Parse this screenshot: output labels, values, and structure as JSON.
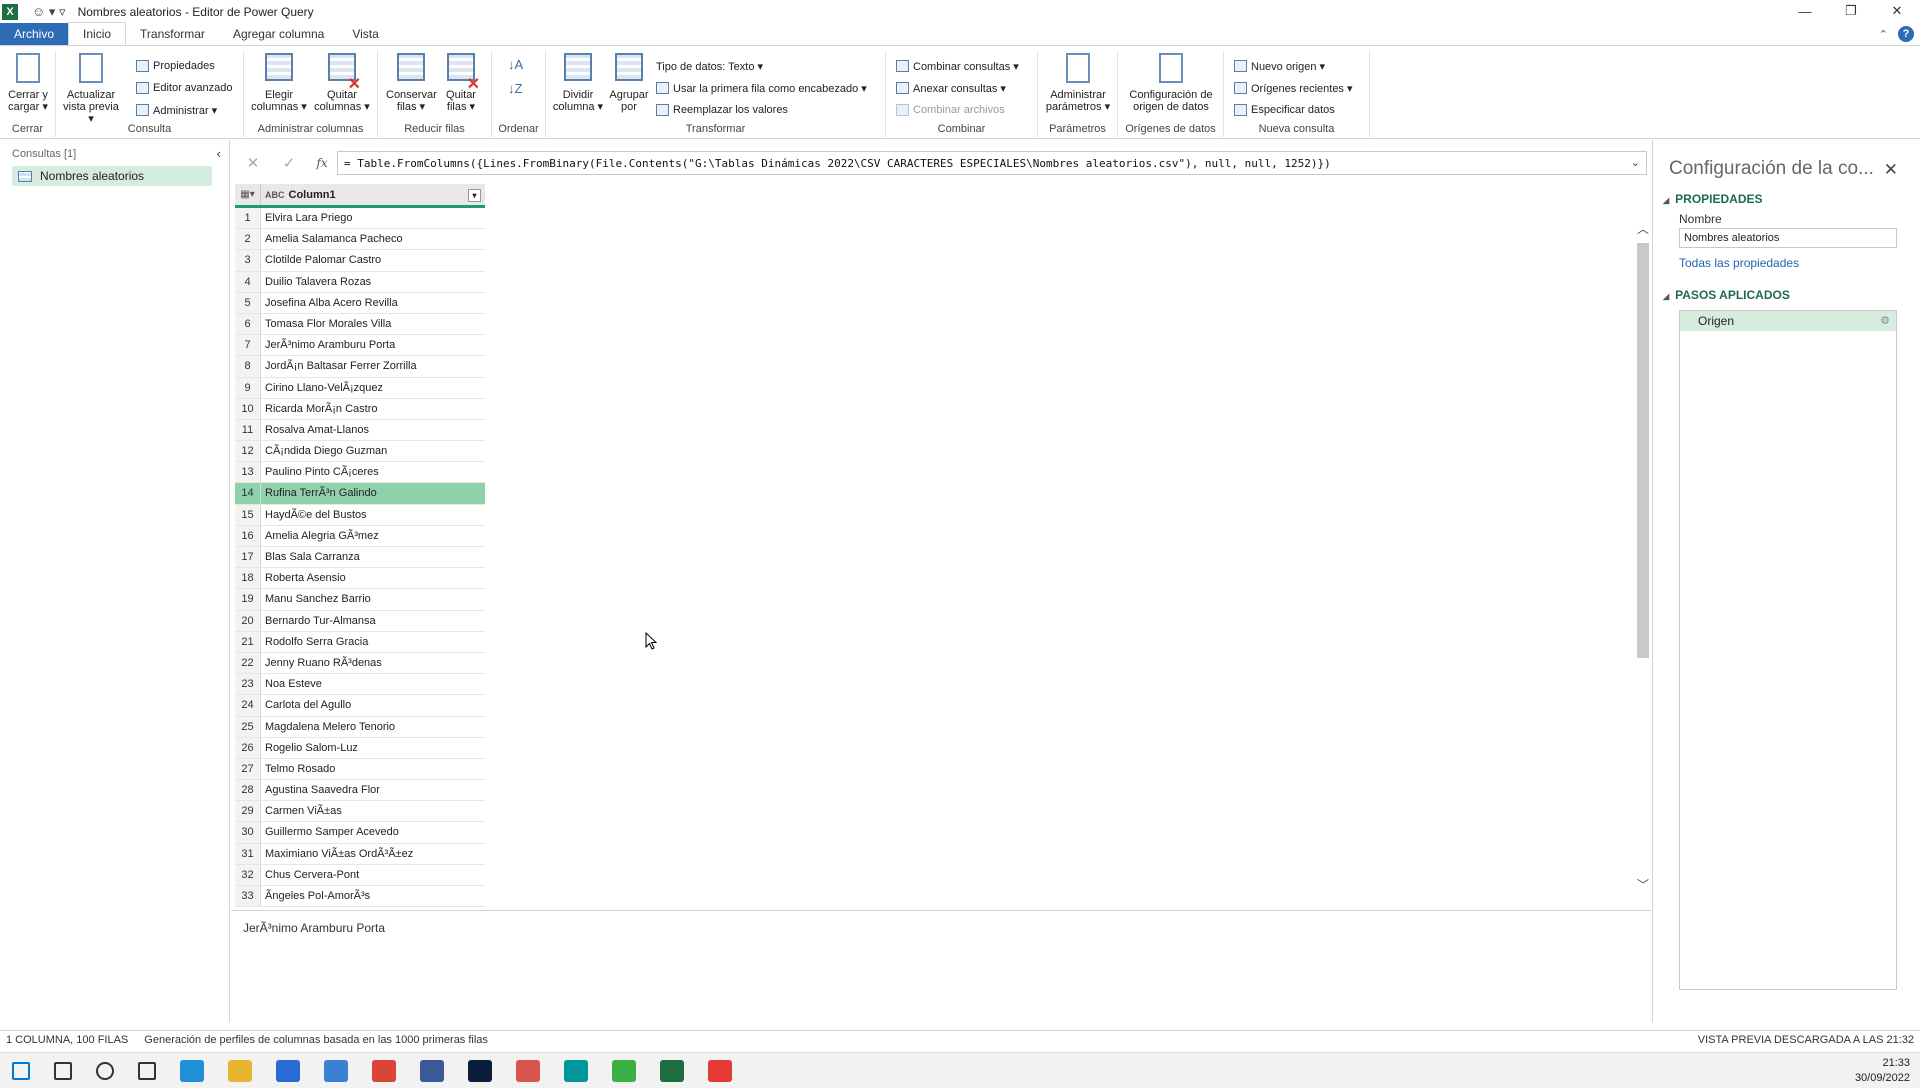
{
  "window": {
    "title": "Nombres aleatorios - Editor de Power Query",
    "app_icon": "X",
    "controls": [
      "—",
      "❐",
      "✕"
    ]
  },
  "ribbon_tabs": [
    "Archivo",
    "Inicio",
    "Transformar",
    "Agregar columna",
    "Vista"
  ],
  "ribbon": {
    "cerrar": {
      "group": "Cerrar",
      "close_load": "Cerrar y cargar ▾"
    },
    "consulta": {
      "group": "Consulta",
      "refresh": "Actualizar vista previa ▾",
      "properties": "Propiedades",
      "advanced_editor": "Editor avanzado",
      "manage": "Administrar ▾"
    },
    "admin_columnas": {
      "group": "Administrar columnas",
      "choose": "Elegir columnas ▾",
      "remove": "Quitar columnas ▾"
    },
    "reducir_filas": {
      "group": "Reducir filas",
      "keep": "Conservar filas ▾",
      "remove": "Quitar filas ▾"
    },
    "ordenar": {
      "group": "Ordenar"
    },
    "transformar": {
      "group": "Transformar",
      "split": "Dividir columna ▾",
      "group_by": "Agrupar por",
      "data_type": "Tipo de datos: Texto ▾",
      "first_row": "Usar la primera fila como encabezado ▾",
      "replace": "Reemplazar los valores"
    },
    "combinar": {
      "group": "Combinar",
      "merge": "Combinar consultas ▾",
      "append": "Anexar consultas ▾",
      "combine_files": "Combinar archivos"
    },
    "parametros": {
      "group": "Parámetros",
      "manage_params": "Administrar parámetros ▾"
    },
    "origenes": {
      "group": "Orígenes de datos",
      "settings": "Configuración de origen de datos"
    },
    "nueva_consulta": {
      "group": "Nueva consulta",
      "new_source": "Nuevo origen ▾",
      "recent": "Orígenes recientes ▾",
      "enter_data": "Especificar datos"
    }
  },
  "queries_pane": {
    "header": "Consultas [1]",
    "items": [
      "Nombres aleatorios"
    ]
  },
  "formula": "= Table.FromColumns({Lines.FromBinary(File.Contents(\"G:\\Tablas Dinámicas 2022\\CSV CARACTERES ESPECIALES\\Nombres aleatorios.csv\"), null, null, 1252)})",
  "grid": {
    "column": "Column1",
    "type_icon": "ABC",
    "selected_row": 14,
    "rows": [
      "Elvira Lara Priego",
      "Amelia Salamanca Pacheco",
      "Clotilde Palomar Castro",
      "Duilio Talavera Rozas",
      "Josefina Alba Acero Revilla",
      "Tomasa Flor Morales Villa",
      "JerÃ³nimo Aramburu Porta",
      "JordÃ¡n Baltasar Ferrer Zorrilla",
      "Cirino Llano-VelÃ¡zquez",
      "Ricarda MorÃ¡n Castro",
      "Rosalva Amat-Llanos",
      "CÃ¡ndida Diego Guzman",
      "Paulino Pinto CÃ¡ceres",
      "Rufina TerrÃ³n Galindo",
      "HaydÃ©e del Bustos",
      "Amelia Alegria GÃ³mez",
      "Blas Sala Carranza",
      "Roberta Asensio",
      "Manu Sanchez Barrio",
      "Bernardo Tur-Almansa",
      "Rodolfo Serra Gracia",
      "Jenny Ruano RÃ³denas",
      "Noa Esteve",
      "Carlota del Agullo",
      "Magdalena Melero Tenorio",
      "Rogelio Salom-Luz",
      "Telmo Rosado",
      "Agustina Saavedra Flor",
      "Carmen ViÃ±as",
      "Guillermo Samper Acevedo",
      "Maximiano ViÃ±as OrdÃ³Ã±ez",
      "Chus Cervera-Pont",
      "Ãngeles Pol-AmorÃ³s"
    ],
    "row_numbers": [
      "1",
      "2",
      "3",
      "4",
      "5",
      "6",
      "7",
      "8",
      "9",
      "10",
      "11",
      "12",
      "13",
      "14",
      "15",
      "16",
      "17",
      "18",
      "19",
      "20",
      "21",
      "22",
      "23",
      "24",
      "25",
      "26",
      "27",
      "28",
      "29",
      "30",
      "31",
      "32",
      "33"
    ]
  },
  "preview_text": "JerÃ³nimo Aramburu Porta",
  "settings_pane": {
    "title": "Configuración de la co...",
    "properties_header": "PROPIEDADES",
    "name_label": "Nombre",
    "name_value": "Nombres aleatorios",
    "all_properties": "Todas las propiedades",
    "steps_header": "PASOS APLICADOS",
    "steps": [
      "Origen"
    ]
  },
  "status": {
    "left": "1 COLUMNA, 100 FILAS",
    "profiling": "Generación de perfiles de columnas basada en las 1000 primeras filas",
    "right": "VISTA PREVIA DESCARGADA A LAS 21:32"
  },
  "taskbar": {
    "time": "21:33",
    "date": "30/09/2022",
    "icons": [
      "windows-icon",
      "search-icon",
      "cortana-icon",
      "task-view-icon",
      "edge-icon",
      "explorer-icon",
      "store-icon",
      "sync-icon",
      "chrome-icon",
      "app-icon",
      "photoshop-icon",
      "app2-icon",
      "arduino-icon",
      "camtasia-icon",
      "excel-icon",
      "camtasia-recorder-icon"
    ],
    "icon_colors": [
      "#0078d4",
      "#333",
      "#333",
      "#333",
      "#1e8fd8",
      "#e8b530",
      "#2a6bd3",
      "#3a7fd0",
      "#db4437",
      "#3b5998",
      "#0a1d3a",
      "#d9534f",
      "#00979c",
      "#3cb043",
      "#1d6f42",
      "#e53935"
    ]
  },
  "colors": {
    "accent": "#2b6cb5",
    "selection": "#8fd1ab",
    "header_underline": "#1f9c6b",
    "link": "#2364b1"
  }
}
